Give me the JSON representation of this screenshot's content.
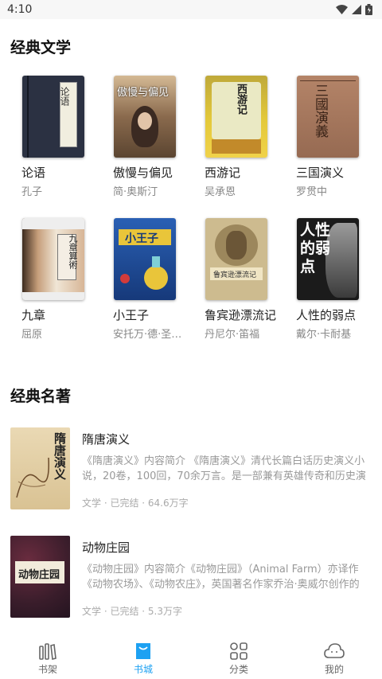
{
  "status_bar": {
    "time": "4:10"
  },
  "sections": [
    {
      "title": "经典文学"
    },
    {
      "title": "经典名著"
    }
  ],
  "grid_books": [
    {
      "title": "论语",
      "author": "孔子",
      "cover_text": "论语",
      "cover_color": "#2d3447"
    },
    {
      "title": "傲慢与偏见",
      "author": "简·奥斯汀",
      "cover_text": "傲慢与偏见",
      "cover_color": "#7a5a3e"
    },
    {
      "title": "西游记",
      "author": "吴承恩",
      "cover_text": "西游记",
      "cover_color": "#d4b020"
    },
    {
      "title": "三国演义",
      "author": "罗贯中",
      "cover_text": "三國演義",
      "cover_color": "#a0735a"
    },
    {
      "title": "九章",
      "author": "屈原",
      "cover_text": "九章算術",
      "cover_color": "#c9a07a"
    },
    {
      "title": "小王子",
      "author": "安托万·德·圣-埃克苏佩里",
      "cover_text": "小王子",
      "cover_color": "#1e4f9a"
    },
    {
      "title": "鲁宾逊漂流记",
      "author": "丹尼尔·笛福",
      "cover_text": "鲁宾逊漂流记",
      "cover_color": "#c6b48a"
    },
    {
      "title": "人性的弱点",
      "author": "戴尔·卡耐基",
      "cover_text": "人性的弱点",
      "cover_color": "#1b1b1b"
    }
  ],
  "list_books": [
    {
      "title": "隋唐演义",
      "desc": "《隋唐演义》内容简介 《隋唐演义》清代长篇白话历史演义小说，20卷，100回，70余万言。是一部兼有英雄传奇和历史演义特色的小说",
      "meta": "文学 · 已完结 · 64.6万字",
      "cover_text": "隋唐演义",
      "cover_color": "#e6d7b0"
    },
    {
      "title": "动物庄园",
      "desc": "《动物庄园》内容简介《动物庄园》（Animal Farm）亦译作《动物农场》、《动物农庄》，英国著名作家乔治·奥威尔创作的中篇小说",
      "meta": "文学 · 已完结 · 5.3万字",
      "cover_text": "动物庄园",
      "cover_color": "#3b1f2e"
    }
  ],
  "bottom_nav": [
    {
      "label": "书架",
      "icon": "bookshelf-icon"
    },
    {
      "label": "书城",
      "icon": "bookstore-icon"
    },
    {
      "label": "分类",
      "icon": "category-icon"
    },
    {
      "label": "我的",
      "icon": "profile-icon"
    }
  ],
  "colors": {
    "accent": "#1da1f2"
  }
}
